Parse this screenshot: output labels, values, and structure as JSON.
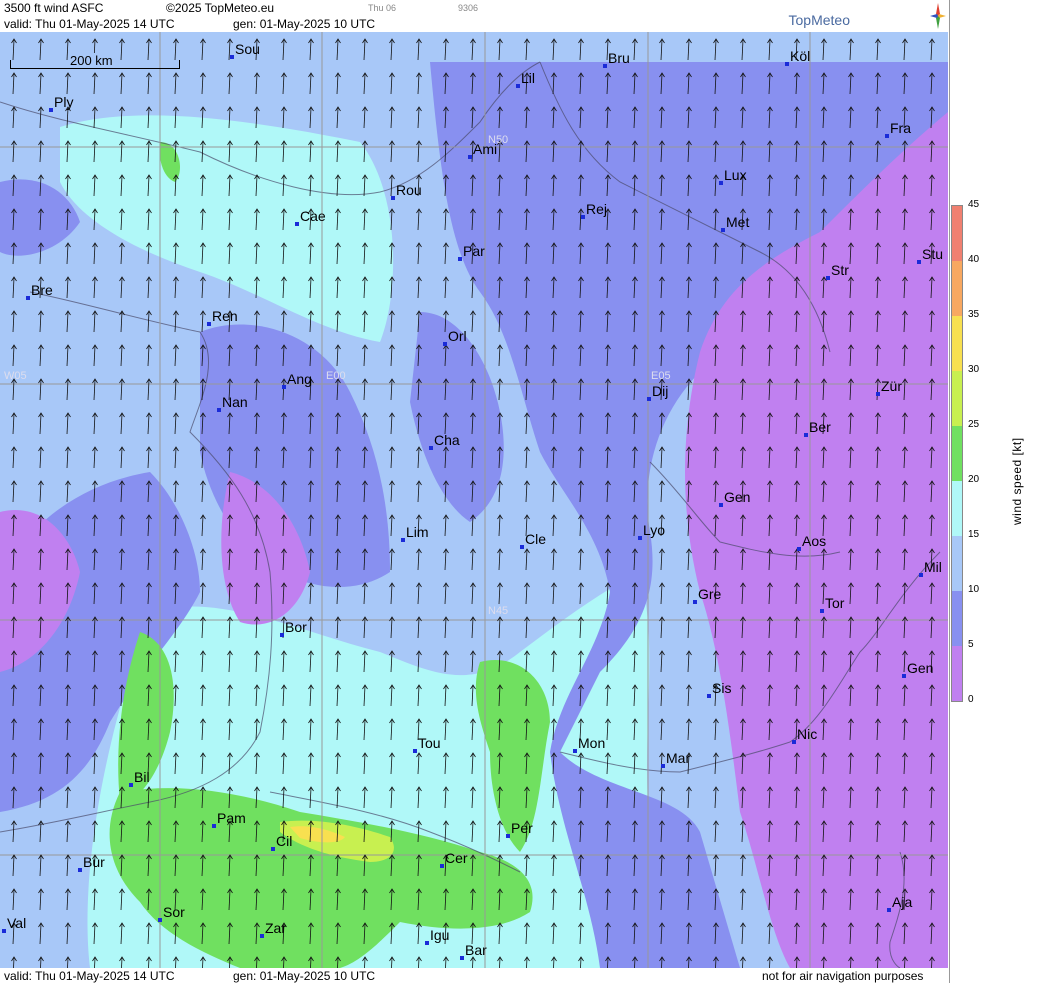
{
  "header": {
    "title": "3500 ft wind ASFC",
    "copyright": "©2025 TopMeteo.eu",
    "valid_line": "valid:  Thu  01-May-2025  14 UTC",
    "gen_line": "gen: 01-May-2025 10 UTC",
    "small_day": "Thu 06",
    "small_code": "9306",
    "brand": "TopMeteo"
  },
  "scale_bar": {
    "label": "200 km"
  },
  "grid_labels": [
    "N50",
    "N45",
    "E00",
    "E05",
    "W05"
  ],
  "cities": [
    {
      "name": "Sou"
    },
    {
      "name": "Ply"
    },
    {
      "name": "Lil"
    },
    {
      "name": "Bru"
    },
    {
      "name": "Köl"
    },
    {
      "name": "Fra"
    },
    {
      "name": "Ami"
    },
    {
      "name": "Rou"
    },
    {
      "name": "Cae"
    },
    {
      "name": "Lux"
    },
    {
      "name": "Rej"
    },
    {
      "name": "Met"
    },
    {
      "name": "Par"
    },
    {
      "name": "Bre"
    },
    {
      "name": "Str"
    },
    {
      "name": "Stu"
    },
    {
      "name": "Ren"
    },
    {
      "name": "Orl"
    },
    {
      "name": "Ang"
    },
    {
      "name": "Nan"
    },
    {
      "name": "Dij"
    },
    {
      "name": "Zür"
    },
    {
      "name": "Cha"
    },
    {
      "name": "Ber"
    },
    {
      "name": "Gen"
    },
    {
      "name": "Lim"
    },
    {
      "name": "Cle"
    },
    {
      "name": "Lyo"
    },
    {
      "name": "Aos"
    },
    {
      "name": "Mil"
    },
    {
      "name": "Gre"
    },
    {
      "name": "Tor"
    },
    {
      "name": "Bor"
    },
    {
      "name": "Sis"
    },
    {
      "name": "Gen"
    },
    {
      "name": "Nic"
    },
    {
      "name": "Tou"
    },
    {
      "name": "Mon"
    },
    {
      "name": "Mar"
    },
    {
      "name": "Bil"
    },
    {
      "name": "Pam"
    },
    {
      "name": "Cil"
    },
    {
      "name": "Per"
    },
    {
      "name": "Cer"
    },
    {
      "name": "Bur"
    },
    {
      "name": "Sor"
    },
    {
      "name": "Val"
    },
    {
      "name": "Zar"
    },
    {
      "name": "Igu"
    },
    {
      "name": "Bar"
    },
    {
      "name": "Aja"
    }
  ],
  "colorbar": {
    "title": "wind speed [kt]",
    "ticks": [
      "45",
      "40",
      "35",
      "30",
      "25",
      "20",
      "15",
      "10",
      "5",
      "0"
    ],
    "colors": [
      "#f08070",
      "#f8a860",
      "#f8e050",
      "#c8f050",
      "#70e060",
      "#b0f8f8",
      "#a8c8f8",
      "#8890f0",
      "#c080f0"
    ]
  },
  "footer": {
    "valid_line": "valid:  Thu  01-May-2025  14 UTC",
    "gen_line": "gen: 01-May-2025 10 UTC",
    "note": "not for air navigation purposes"
  }
}
